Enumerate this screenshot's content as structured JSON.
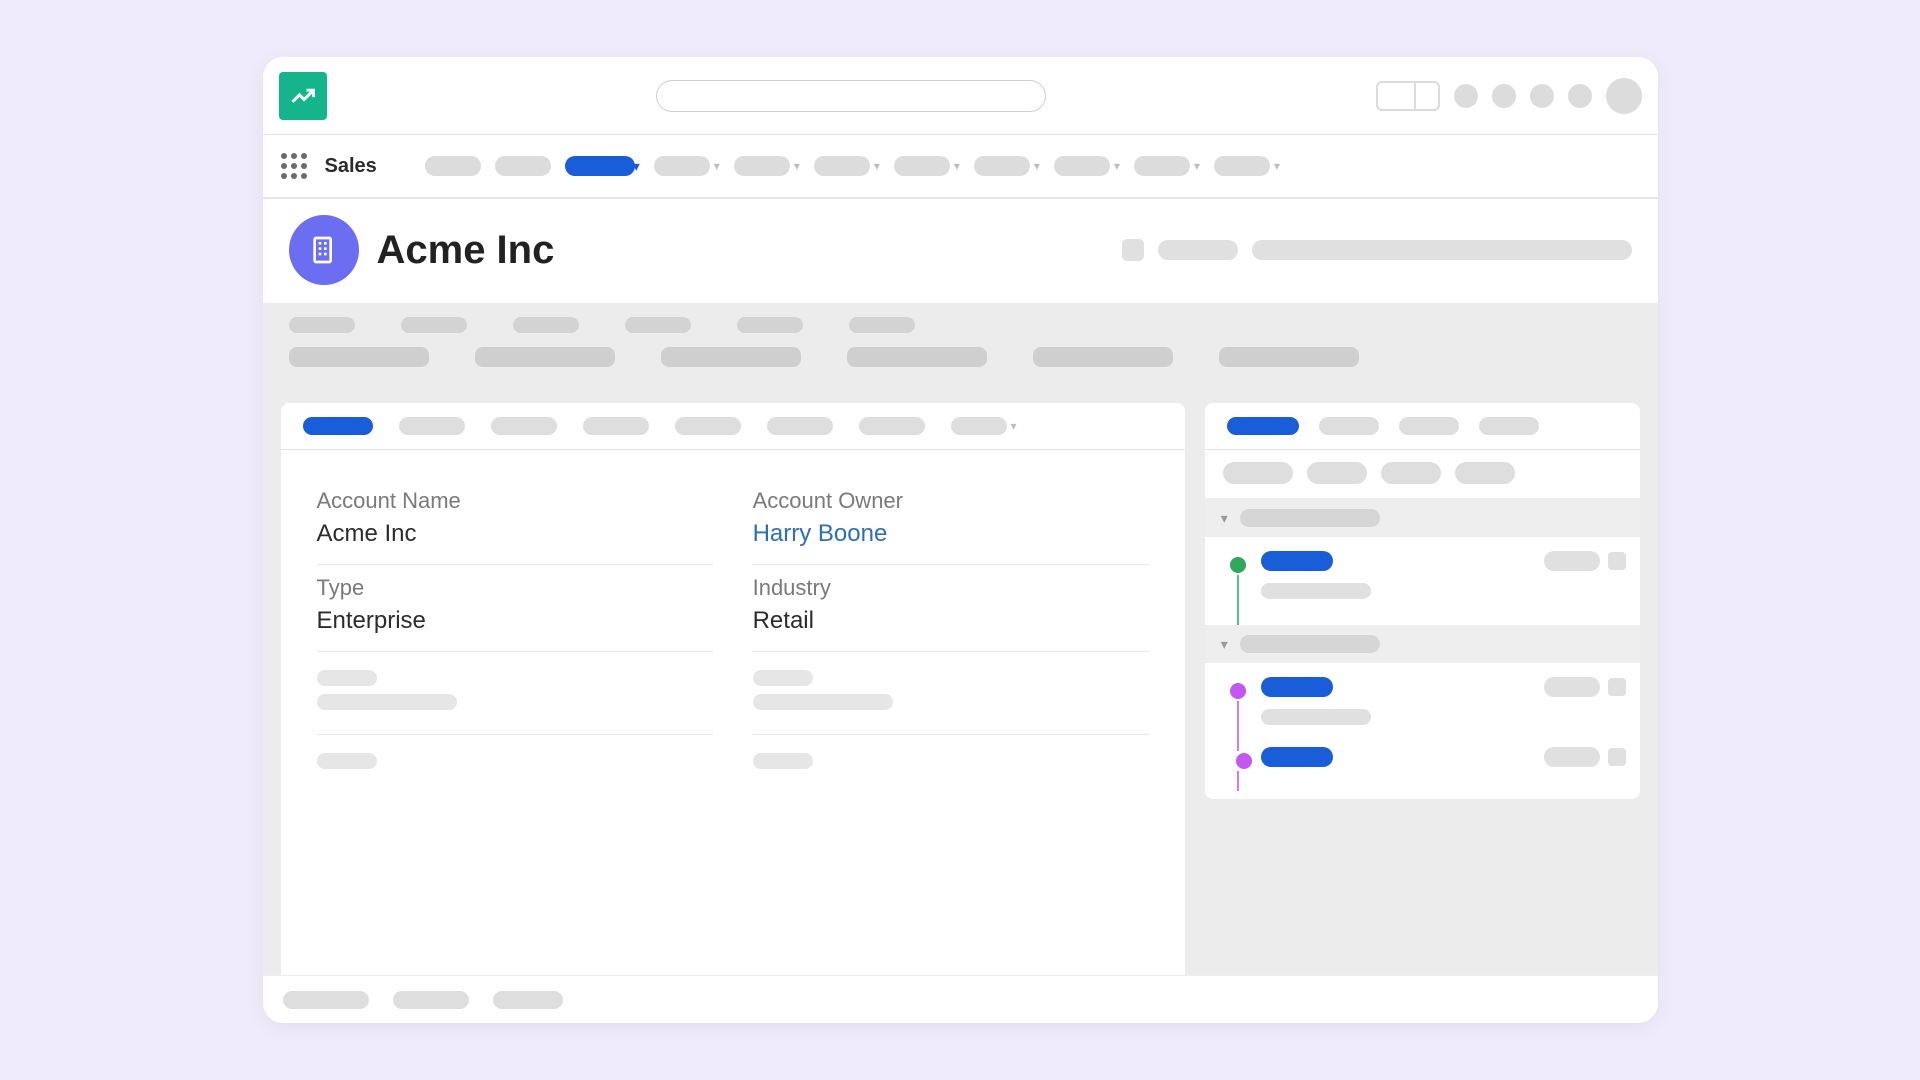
{
  "nav": {
    "app_name": "Sales"
  },
  "record": {
    "title": "Acme Inc"
  },
  "details": {
    "account_name_label": "Account Name",
    "account_name_value": "Acme Inc",
    "account_owner_label": "Account Owner",
    "account_owner_value": "Harry Boone",
    "type_label": "Type",
    "type_value": "Enterprise",
    "industry_label": "Industry",
    "industry_value": "Retail"
  },
  "colors": {
    "accent": "#1a5dd8",
    "brand_logo": "#14b58a",
    "record_icon": "#6b6ef0",
    "timeline_green": "#2fa85b",
    "timeline_purple": "#c357ef"
  }
}
